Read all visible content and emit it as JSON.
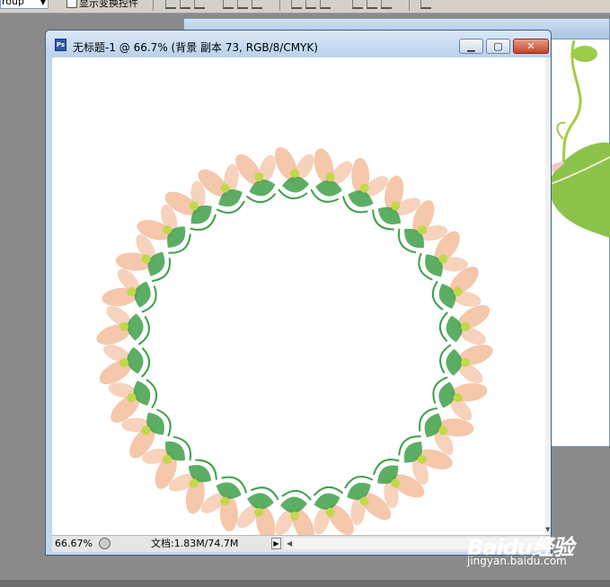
{
  "options_bar": {
    "auto_select_value": "roup",
    "show_transform_label": "显示变换控件"
  },
  "document": {
    "title": "无标题-1 @ 66.7% (背景 副本 73, RGB/8/CMYK)",
    "zoom": "66.67%",
    "doc_info": "文档:1.83M/74.7M"
  },
  "watermark": {
    "brand": "Baidu经验",
    "url": "jingyan.baidu.com"
  },
  "colors": {
    "wreath_petal": "#f2b48f",
    "wreath_leaf": "#3fa04a",
    "wreath_bud": "#c2d84a"
  },
  "icons": [
    "photoshop-doc-icon",
    "minimize-icon",
    "maximize-icon",
    "close-icon",
    "status-menu-icon",
    "play-arrow-icon",
    "scroll-left-icon",
    "scroll-down-icon"
  ]
}
